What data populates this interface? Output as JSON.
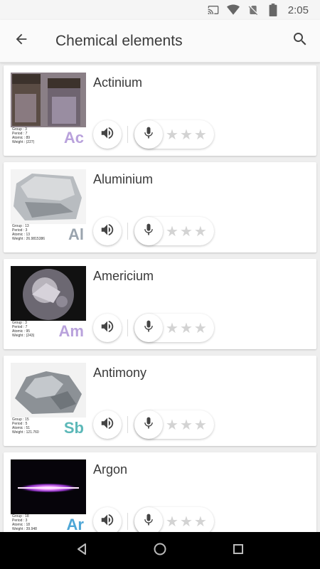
{
  "status_bar": {
    "time": "2:05"
  },
  "app_bar": {
    "title": "Chemical elements"
  },
  "elements": [
    {
      "name": "Actinium",
      "symbol": "Ac",
      "symbol_color": "#b9a2dc",
      "info": [
        "Group    :  3",
        "Period    :  7",
        "Atomic   :  89",
        "Weight   :  (227)"
      ]
    },
    {
      "name": "Aluminium",
      "symbol": "Al",
      "symbol_color": "#9aa4ae",
      "info": [
        "Group    :  13",
        "Period    :  3",
        "Atomic   :  13",
        "Weight   :  26.9815386"
      ]
    },
    {
      "name": "Americium",
      "symbol": "Am",
      "symbol_color": "#b9a2dc",
      "info": [
        "Group    :  3",
        "Period    :  7",
        "Atomic   :  95",
        "Weight   :  (243)"
      ]
    },
    {
      "name": "Antimony",
      "symbol": "Sb",
      "symbol_color": "#5cb8b8",
      "info": [
        "Group    :  15",
        "Period    :  5",
        "Atomic   :  51",
        "Weight   :  121.760"
      ]
    },
    {
      "name": "Argon",
      "symbol": "Ar",
      "symbol_color": "#4da6d6",
      "info": [
        "Group    :  18",
        "Period    :  3",
        "Atomic   :  18",
        "Weight   :  39.948"
      ]
    }
  ]
}
